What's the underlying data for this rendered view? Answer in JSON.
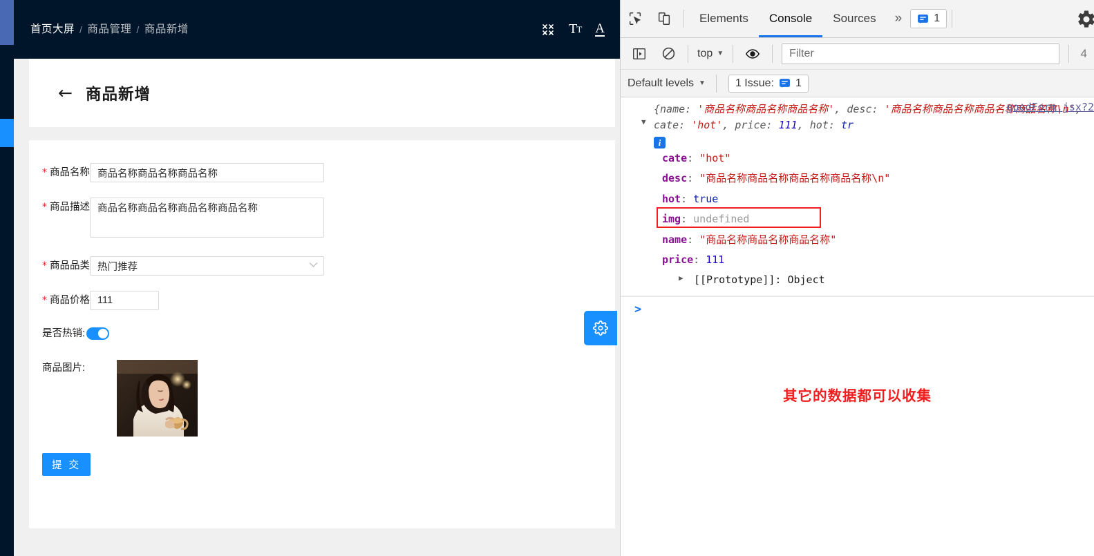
{
  "page": {
    "breadcrumb": [
      {
        "label": "首页大屏"
      },
      {
        "label": "商品管理"
      },
      {
        "label": "商品新增"
      }
    ],
    "breadcrumb_separator": "/",
    "topbar_icons": [
      {
        "name": "fullscreen-exit-icon",
        "glyph": "⤫"
      },
      {
        "name": "text-size-icon",
        "glyph": "Tт"
      },
      {
        "name": "font-color-icon",
        "glyph": "A"
      }
    ],
    "back_arrow": "←",
    "title": "商品新增",
    "form": {
      "required_marker": "*",
      "fields": [
        {
          "key": "name",
          "label": "商品名称",
          "required": true,
          "type": "text",
          "value": "商品名称商品名称商品名称"
        },
        {
          "key": "desc",
          "label": "商品描述",
          "required": true,
          "type": "textarea",
          "value": "商品名称商品名称商品名称商品名称"
        },
        {
          "key": "cate",
          "label": "商品品类",
          "required": true,
          "type": "select",
          "value": "热门推荐"
        },
        {
          "key": "price",
          "label": "商品价格",
          "required": true,
          "type": "number",
          "value": "111"
        }
      ],
      "hot_label": "是否热销:",
      "hot_value": true,
      "image_label": "商品图片:",
      "submit_label": "提 交"
    },
    "fab": {
      "name": "settings-gear-fab",
      "glyph": "⚙"
    },
    "colors": {
      "sidebar_bg": "#001529",
      "sidebar_accent": "#4a69b5",
      "sidebar_active": "#1890ff",
      "primary": "#1890ff",
      "required": "#f5222d"
    }
  },
  "devtools": {
    "tabs": [
      {
        "label": "Elements",
        "active": false
      },
      {
        "label": "Console",
        "active": true
      },
      {
        "label": "Sources",
        "active": false
      }
    ],
    "more_tabs_glyph": "»",
    "issue_badge_count": "1",
    "settings_icon": "gear-icon",
    "console_toolbar": {
      "context": "top",
      "filter_placeholder": "Filter",
      "filter_value": "",
      "hidden_count": "4"
    },
    "level_bar": {
      "levels_label": "Default levels",
      "issues_label": "1 Issue:",
      "issues_count": "1"
    },
    "console": {
      "source_link": "goodForm.jsx?2",
      "preview": {
        "open_brace": "{",
        "t1": "name: ",
        "v1": "'商品名称商品名称商品名称'",
        "t2": ", desc: ",
        "v2": "'商品名称商品名称商品名称商品名称\\n'",
        "t3": ", cate: ",
        "v3": "'hot'",
        "t4": ", price: ",
        "v4": "111",
        "t5": ", hot: ",
        "v5": "tr"
      },
      "disclosure_glyph": "▼",
      "info_badge": "i",
      "properties": [
        {
          "key": "cate",
          "value": "\"hot\"",
          "kind": "string",
          "highlight": false
        },
        {
          "key": "desc",
          "value": "\"商品名称商品名称商品名称商品名称\\n\"",
          "kind": "string",
          "highlight": false
        },
        {
          "key": "hot",
          "value": "true",
          "kind": "bool",
          "highlight": false
        },
        {
          "key": "img",
          "value": "undefined",
          "kind": "undefined",
          "highlight": true
        },
        {
          "key": "name",
          "value": "\"商品名称商品名称商品名称\"",
          "kind": "string",
          "highlight": false
        },
        {
          "key": "price",
          "value": "111",
          "kind": "number",
          "highlight": false
        }
      ],
      "prototype_label": "[[Prototype]]: Object",
      "prototype_triangle": "▶",
      "prompt_caret": ">",
      "annotation": "其它的数据都可以收集"
    }
  }
}
